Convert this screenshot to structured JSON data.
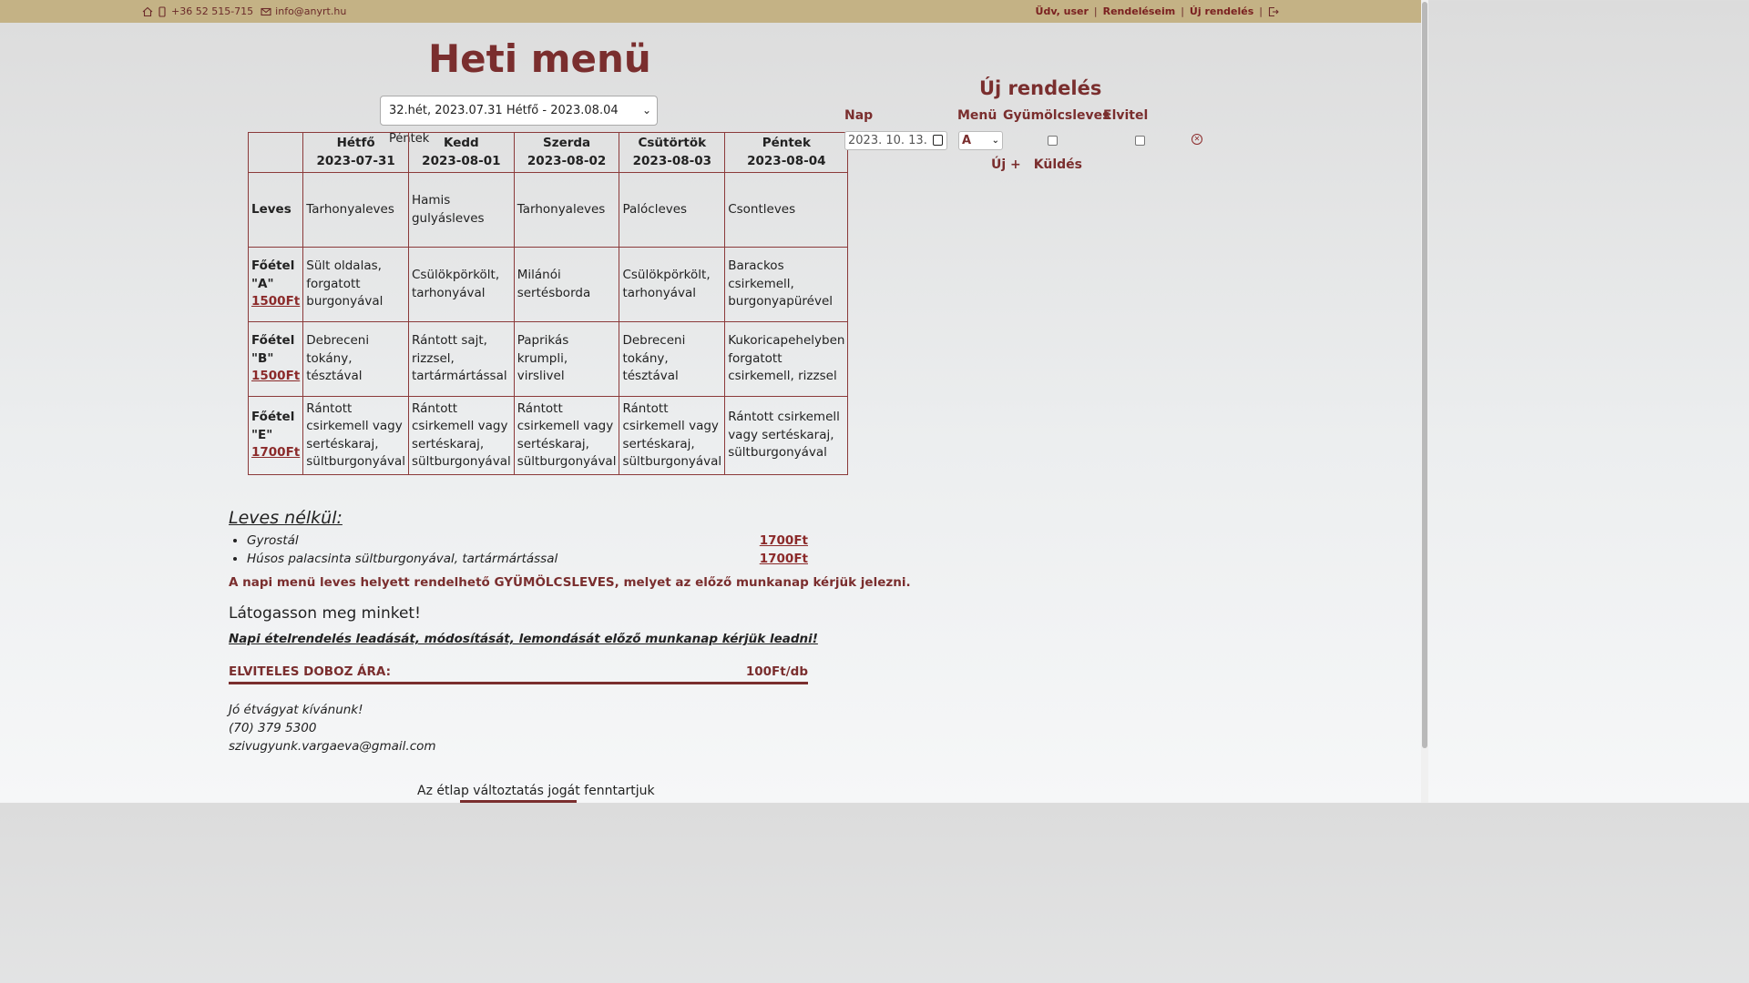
{
  "topbar": {
    "phone": "+36 52 515-715",
    "email": "info@anyrt.hu",
    "greeting": "Üdv, user",
    "orders_link": "Rendeléseim",
    "new_order_link": "Új rendelés",
    "separator": "|"
  },
  "menu": {
    "title": "Heti menü",
    "week_selected": "32.hét, 2023.07.31 Hétfő - 2023.08.04 Péntek",
    "days": [
      {
        "name": "Hétfő",
        "date": "2023-07-31"
      },
      {
        "name": "Kedd",
        "date": "2023-08-01"
      },
      {
        "name": "Szerda",
        "date": "2023-08-02"
      },
      {
        "name": "Csütörtök",
        "date": "2023-08-03"
      },
      {
        "name": "Péntek",
        "date": "2023-08-04"
      }
    ],
    "rows": [
      {
        "label": "Leves",
        "price": "",
        "items": [
          "Tarhonyaleves",
          "Hamis gulyásleves",
          "Tarhonyaleves",
          "Palócleves",
          "Csontleves"
        ]
      },
      {
        "label": "Főétel \"A\"",
        "price": "1500Ft",
        "items": [
          "Sült oldalas, forgatott burgonyával",
          "Csülökpörkölt, tarhonyával",
          "Milánói sertésborda",
          "Csülökpörkölt, tarhonyával",
          "Barackos csirkemell, burgonyapürével"
        ]
      },
      {
        "label": "Főétel \"B\"",
        "price": "1500Ft",
        "items": [
          "Debreceni tokány, tésztával",
          "Rántott sajt, rizzsel, tartármártással",
          "Paprikás krumpli, virslivel",
          "Debreceni tokány, tésztával",
          "Kukoricapehelyben forgatott csirkemell, rizzsel"
        ]
      },
      {
        "label": "Főétel \"E\"",
        "price": "1700Ft",
        "items": [
          "Rántott csirkemell vagy sertéskaraj, sültburgonyával",
          "Rántott csirkemell vagy sertéskaraj, sültburgonyával",
          "Rántott csirkemell vagy sertéskaraj, sültburgonyával",
          "Rántott csirkemell vagy sertéskaraj, sültburgonyával",
          "Rántott csirkemell vagy sertéskaraj, sültburgonyával"
        ]
      }
    ]
  },
  "order": {
    "title": "Új rendelés",
    "headers": {
      "day": "Nap",
      "menu": "Menü",
      "fruit_soup": "Gyümölcsleves",
      "takeaway": "Elvitel"
    },
    "date_value": "2023. 10. 13.",
    "menu_value": "A",
    "add_label": "Új +",
    "send_label": "Küldés"
  },
  "extras": {
    "title": "Leves nélkül:",
    "items": [
      {
        "name": "Gyrostál",
        "price": "1700Ft"
      },
      {
        "name": "Húsos palacsinta sültburgonyával, tartármártással",
        "price": "1700Ft"
      }
    ],
    "notice": "A napi menü leves helyett rendelhető GYÜMÖLCSLEVES, melyet az előző munkanap kérjük jelezni.",
    "visit": "Látogasson meg minket!",
    "deadline": "Napi ételrendelés leadását, módosítását, lemondását előző munkanap kérjük leadni!",
    "box_label": "ELVITELES DOBOZ ÁRA:",
    "box_price": "100Ft/db",
    "greeting": "Jó étvágyat kívánunk!",
    "phone": "(70) 379 5300",
    "email": "szivugyunk.vargaeva@gmail.com",
    "reserve": "Az étlap változtatás jogát fenntartjuk"
  }
}
